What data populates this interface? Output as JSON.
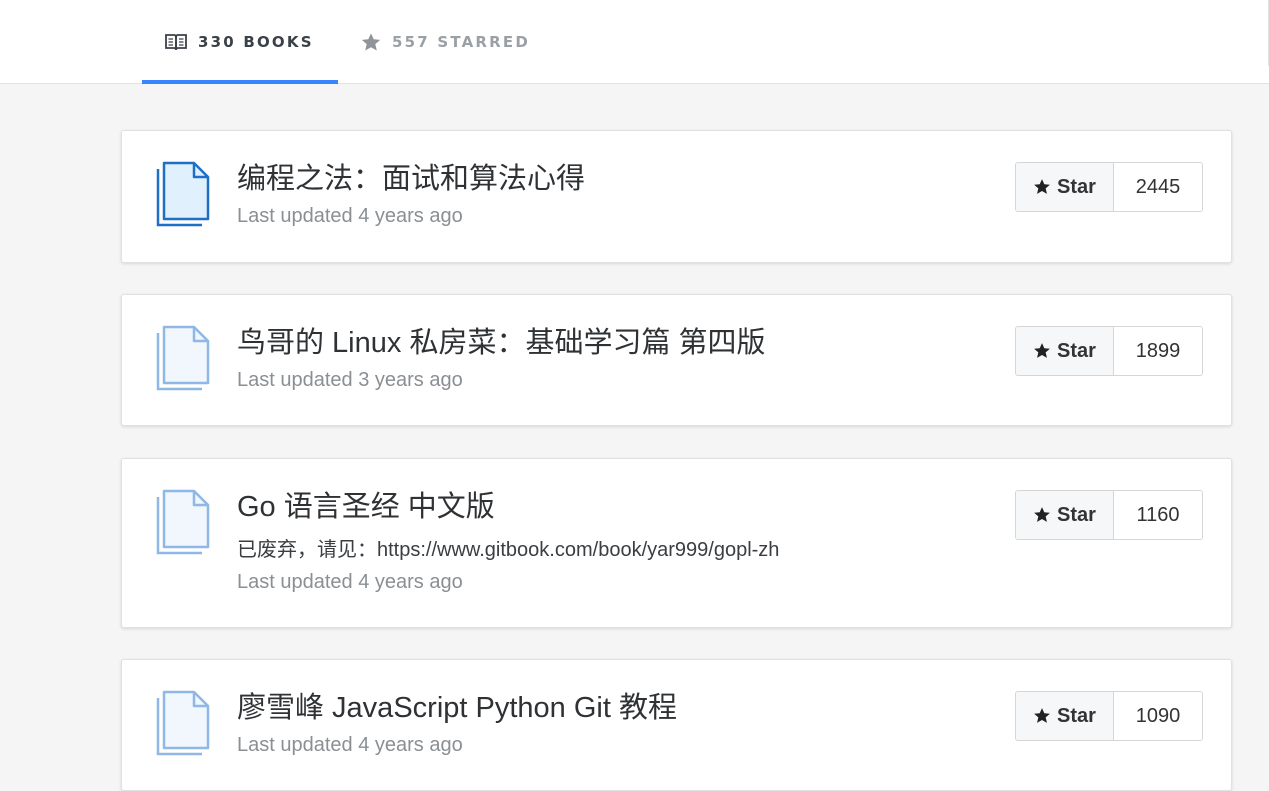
{
  "tabs": {
    "books": {
      "label": "330 BOOKS",
      "icon": "open-book-icon"
    },
    "starred": {
      "label": "557 STARRED",
      "icon": "star-icon"
    }
  },
  "accent_color": "#3884ff",
  "star_label": "Star",
  "books": [
    {
      "title": "编程之法：面试和算法心得",
      "description": "",
      "updated": "Last updated 4 years ago",
      "stars": "2445",
      "icon": "document-icon"
    },
    {
      "title": "鸟哥的 Linux 私房菜：基础学习篇 第四版",
      "description": "",
      "updated": "Last updated 3 years ago",
      "stars": "1899",
      "icon": "document-icon"
    },
    {
      "title": "Go 语言圣经 中文版",
      "description": "已废弃，请见：https://www.gitbook.com/book/yar999/gopl-zh",
      "updated": "Last updated 4 years ago",
      "stars": "1160",
      "icon": "document-icon"
    },
    {
      "title": "廖雪峰 JavaScript Python Git 教程",
      "description": "",
      "updated": "Last updated 4 years ago",
      "stars": "1090",
      "icon": "document-icon"
    }
  ]
}
